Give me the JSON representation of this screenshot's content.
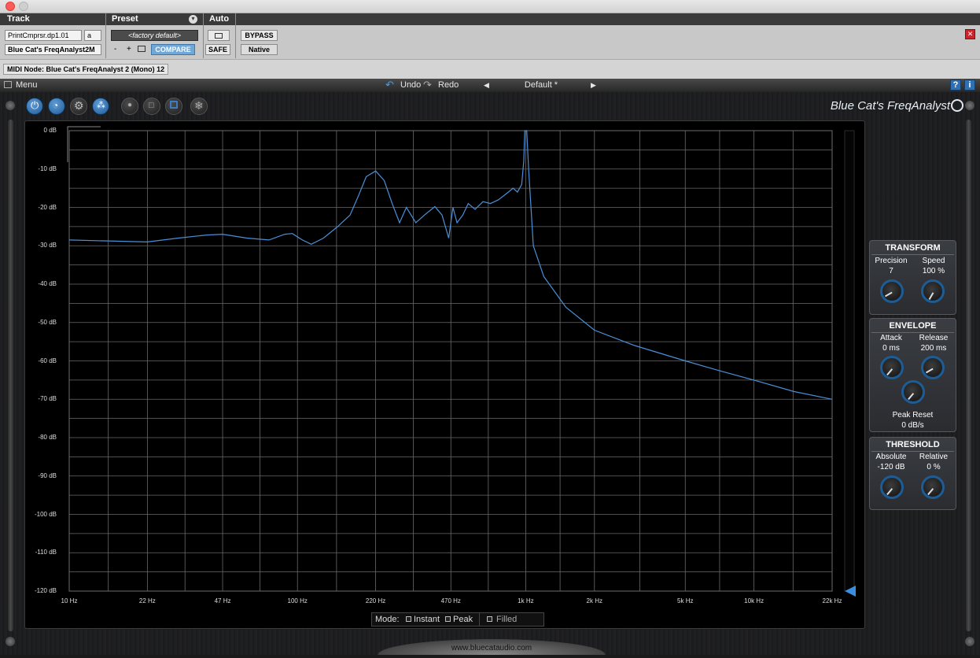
{
  "header": {
    "track_label": "Track",
    "preset_label": "Preset",
    "auto_label": "Auto",
    "track_name": "PrintCmprsr.dp1.01",
    "track_slot": "a",
    "plugin_name": "Blue Cat's FreqAnalyst2M",
    "preset_value": "<factory default>",
    "minus": "-",
    "plus": "+",
    "compare": "COMPARE",
    "bypass": "BYPASS",
    "safe": "SAFE",
    "native": "Native",
    "midi_node": "MIDI Node: Blue Cat's FreqAnalyst 2 (Mono) 12"
  },
  "menubar": {
    "menu": "Menu",
    "undo": "Undo",
    "redo": "Redo",
    "preset_name": "Default *",
    "help": "?",
    "info": "i"
  },
  "brand": "Blue Cat's FreqAnalyst",
  "chart_data": {
    "type": "line",
    "yticks": [
      "0 dB",
      "-10 dB",
      "-20 dB",
      "-30 dB",
      "-40 dB",
      "-50 dB",
      "-60 dB",
      "-70 dB",
      "-80 dB",
      "-90 dB",
      "-100 dB",
      "-110 dB",
      "-120 dB"
    ],
    "xticks": [
      "10 Hz",
      "22 Hz",
      "47 Hz",
      "100 Hz",
      "220 Hz",
      "470 Hz",
      "1k Hz",
      "2k Hz",
      "5k Hz",
      "10k Hz",
      "22k Hz"
    ],
    "ylim": [
      -120,
      0
    ],
    "xlim": [
      10,
      22000
    ],
    "xscale": "log",
    "grid": true,
    "line_color": "#4a90d9",
    "series": [
      {
        "points": [
          [
            10,
            -28.5
          ],
          [
            16,
            -28.8
          ],
          [
            22,
            -29
          ],
          [
            30,
            -28
          ],
          [
            40,
            -27.2
          ],
          [
            47,
            -27
          ],
          [
            60,
            -28
          ],
          [
            75,
            -28.5
          ],
          [
            88,
            -27
          ],
          [
            95,
            -26.8
          ],
          [
            105,
            -28.5
          ],
          [
            115,
            -29.6
          ],
          [
            130,
            -28
          ],
          [
            150,
            -25
          ],
          [
            170,
            -22
          ],
          [
            185,
            -17
          ],
          [
            200,
            -12
          ],
          [
            220,
            -10.5
          ],
          [
            240,
            -13
          ],
          [
            260,
            -19
          ],
          [
            280,
            -24
          ],
          [
            300,
            -20
          ],
          [
            330,
            -24
          ],
          [
            360,
            -22
          ],
          [
            400,
            -19.8
          ],
          [
            430,
            -22
          ],
          [
            460,
            -28
          ],
          [
            480,
            -20
          ],
          [
            500,
            -24
          ],
          [
            530,
            -22
          ],
          [
            560,
            -19
          ],
          [
            600,
            -20.5
          ],
          [
            650,
            -18.5
          ],
          [
            700,
            -19
          ],
          [
            760,
            -18
          ],
          [
            820,
            -16.5
          ],
          [
            880,
            -15
          ],
          [
            920,
            -16
          ],
          [
            960,
            -14
          ],
          [
            980,
            -8
          ],
          [
            990,
            0
          ],
          [
            1010,
            0
          ],
          [
            1030,
            -10
          ],
          [
            1080,
            -30
          ],
          [
            1200,
            -38
          ],
          [
            1500,
            -46
          ],
          [
            2000,
            -52
          ],
          [
            3000,
            -56
          ],
          [
            5000,
            -60
          ],
          [
            7000,
            -62.5
          ],
          [
            10000,
            -65
          ],
          [
            15000,
            -68
          ],
          [
            22000,
            -70
          ]
        ]
      }
    ]
  },
  "mode": {
    "label": "Mode:",
    "instant": "Instant",
    "peak": "Peak",
    "filled": "Filled"
  },
  "transform": {
    "title": "TRANSFORM",
    "precision_label": "Precision",
    "precision_value": "7",
    "speed_label": "Speed",
    "speed_value": "100 %"
  },
  "envelope": {
    "title": "ENVELOPE",
    "attack_label": "Attack",
    "attack_value": "0 ms",
    "release_label": "Release",
    "release_value": "200 ms",
    "peak_reset_label": "Peak Reset",
    "peak_reset_value": "0 dB/s"
  },
  "threshold": {
    "title": "THRESHOLD",
    "absolute_label": "Absolute",
    "absolute_value": "-120 dB",
    "relative_label": "Relative",
    "relative_value": "0 %"
  },
  "footer_url": "www.bluecataudio.com"
}
